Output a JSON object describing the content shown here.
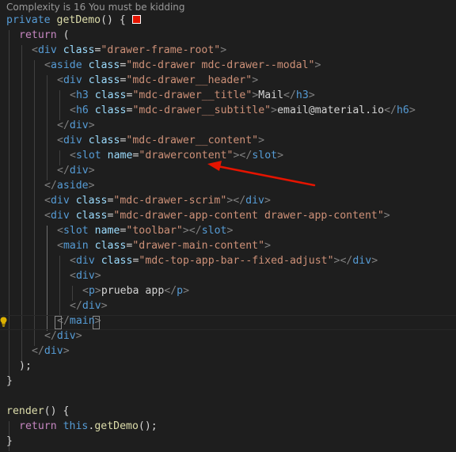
{
  "code_lens": "Complexity is 16 You must be kidding",
  "method": {
    "modifier": "private",
    "name": "getDemo",
    "open": "() {"
  },
  "ret": "return",
  "this_kw": "this",
  "call": "getDemo",
  "render_name": "render",
  "el": {
    "div": "div",
    "aside": "aside",
    "h3": "h3",
    "h6": "h6",
    "slot": "slot",
    "main": "main",
    "p": "p",
    "class_attr": "class",
    "name_attr": "name"
  },
  "vals": {
    "root": "\"drawer-frame-root\"",
    "drawer": "\"mdc-drawer mdc-drawer--modal\"",
    "header": "\"mdc-drawer__header\"",
    "title": "\"mdc-drawer__title\"",
    "subtitle": "\"mdc-drawer__subtitle\"",
    "content": "\"mdc-drawer__content\"",
    "drawercontent": "\"drawercontent\"",
    "scrim": "\"mdc-drawer-scrim\"",
    "app_content": "\"mdc-drawer-app-content drawer-app-content\"",
    "toolbar": "\"toolbar\"",
    "main_content": "\"drawer-main-content\"",
    "top_bar": "\"mdc-top-app-bar--fixed-adjust\""
  },
  "text": {
    "mail": "Mail",
    "email": "email@material.io",
    "prueba": "prueba app"
  },
  "colors": {
    "background": "#1e1e1e",
    "keyword": "#569cd6",
    "control": "#c586c0",
    "function": "#dcdcaa",
    "attribute": "#9cdcfe",
    "string": "#ce9178",
    "bracket": "#808080",
    "annotation_arrow": "#e51400"
  },
  "icons": [
    "error-square-icon",
    "lightbulb-icon",
    "red-arrow-annotation"
  ]
}
